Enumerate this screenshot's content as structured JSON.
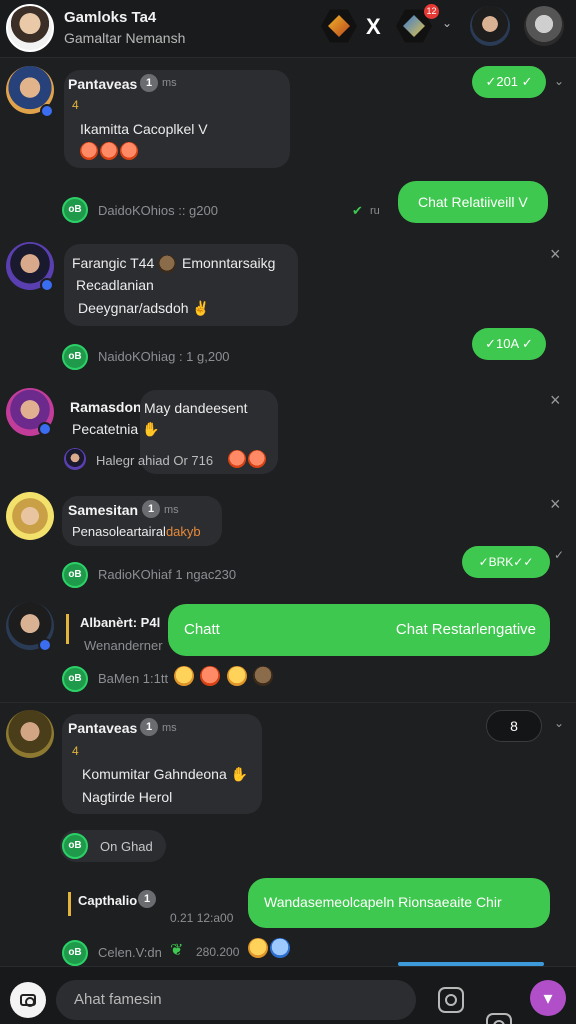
{
  "header": {
    "title": "Gamloks Ta4",
    "subtitle": "Gamaltar Nemansh",
    "close_glyph": "X",
    "notif_count": "12"
  },
  "messages": [
    {
      "sender": "Pantaveas",
      "badge": "1",
      "time": "ms",
      "line1": "4",
      "line2": "Ikamitta Cacoplkel V"
    },
    {
      "out_pill": "✓201 ✓"
    },
    {
      "meta": "DaidoKOhios :: g200",
      "out_mini": "ru",
      "out_text": "Chat Relatiiveill V"
    },
    {
      "sender_line": "Farangic T44",
      "sender_line_rest": "Emonntarsaikg",
      "line2": "Recadlanian",
      "line3": "Deeygnar/adsdoh"
    },
    {
      "meta": "NaidoKOhiag : 1 g,200",
      "out_pill": "✓10A ✓"
    },
    {
      "sender": "Ramasdon",
      "extra": "May dandeesent",
      "line2": "Pecatetnia",
      "reply_meta": "Halegr ahiad Or 716"
    },
    {
      "sender": "Samesitan",
      "badge": "1",
      "time": "ms",
      "line2": "Penasoleartairal",
      "line2_rest": "dakyb"
    },
    {
      "meta": "RadioKOhiaf 1 ngac230",
      "out_pill": "✓BRK✓✓"
    },
    {
      "sender": "Albanèrt: P4l",
      "sub": "Wenanderner",
      "out_left": "Chatt",
      "out_right": "Chat Restarlengative"
    },
    {
      "meta": "BaMen 1:1tt"
    },
    {
      "sender": "Pantaveas",
      "badge": "1",
      "time": "ms",
      "line1": "4",
      "line2": "Komumitar Gahndeona",
      "line3": "Nagtirde Herol",
      "side_pill": "8"
    },
    {
      "meta": "On Ghad"
    },
    {
      "sender": "Capthalio",
      "badge": "1",
      "time_meta": "0.21 12:a00",
      "out_text": "Wandasemeolcapeln Rionsaeaite Chir"
    },
    {
      "meta": "Celen.V:dn",
      "meta2": "280.200"
    }
  ],
  "group_icon_text": "oB",
  "composer": {
    "placeholder": "Ahat famesin"
  },
  "colors": {
    "accent_green": "#3fc84f",
    "send_purple": "#b14fc8",
    "badge_blue": "#3a6df0"
  },
  "icons": [
    "camera-icon",
    "close-icon",
    "chevron-down-icon",
    "check-icon",
    "gallery-icon",
    "send-icon"
  ]
}
